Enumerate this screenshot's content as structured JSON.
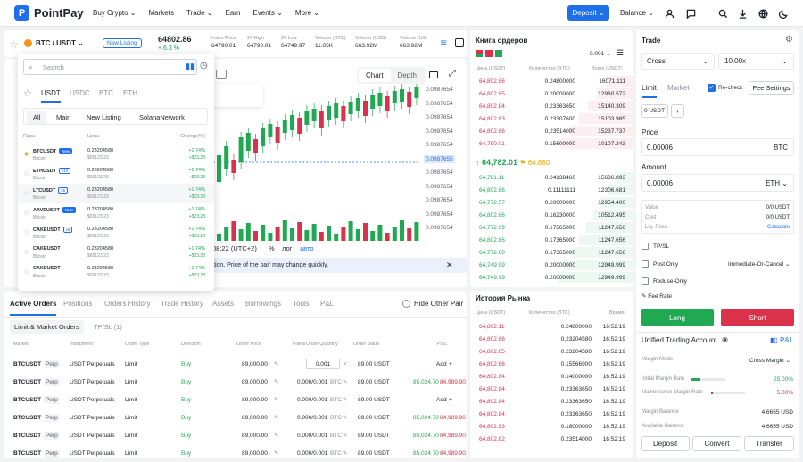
{
  "nav": {
    "brand": "PointPay",
    "items": [
      "Buy Crypto",
      "Markets",
      "Trade",
      "Earn",
      "Events",
      "More"
    ],
    "deposit": "Deposit",
    "balance": "Balance"
  },
  "ticker": {
    "pair": "BTC / USDT",
    "listing": "New Listing",
    "price": "64802.86",
    "change": "+ 6.3 %",
    "stats": [
      {
        "label": "Index Price",
        "value": "64790.01"
      },
      {
        "label": "24 High",
        "value": "64790.01"
      },
      {
        "label": "24 Low",
        "value": "64749.97"
      },
      {
        "label": "Volume (BTC)",
        "value": "11.05K"
      },
      {
        "label": "Volume (USD)",
        "value": "663.92M"
      },
      {
        "label": "Volume (USDT)",
        "value": "663.92M"
      }
    ]
  },
  "chart": {
    "tabs": [
      "Chart",
      "Depth"
    ],
    "y_labels": [
      "0.0987654",
      "0.0987654",
      "0.0987654",
      "0.0987654",
      "0.0987654",
      "0.0987655",
      "0.0987654",
      "0.0987654",
      "0.0987654",
      "0.0987654",
      "0.0987654"
    ],
    "highlight": "0.0987655",
    "time": "08:22 (UTC+2)",
    "pct": "%",
    "log": "лог",
    "auto": "авто",
    "notice": "tion. Price of the pair may change quickly."
  },
  "popup": {
    "search_placeholder": "Search",
    "quotes": [
      "USDT",
      "USDC",
      "BTC",
      "ETH"
    ],
    "cats": [
      "All",
      "Main",
      "New Listing",
      "SolanaNetwork"
    ],
    "col_pair": "Пара",
    "col_price": "Цена",
    "col_change": "Change(%)",
    "rows": [
      {
        "sym": "BTCUSDT",
        "badge": "New",
        "sub": "Bitcoin",
        "price": "0.23204580",
        "price2": "$65123.23",
        "ch": "+1.74%",
        "ch2": "+$23.23",
        "starred": true
      },
      {
        "sym": "ETHUSDT",
        "badge": "x10",
        "sub": "Bitcoin",
        "price": "0.23204580",
        "price2": "$65123.23",
        "ch": "+1.74%",
        "ch2": "+$23.23",
        "starred": false
      },
      {
        "sym": "LTCUSDT",
        "badge": "x5",
        "sub": "Bitcoin",
        "price": "0.23204580",
        "price2": "$65123.23",
        "ch": "+1.74%",
        "ch2": "+$23.23",
        "starred": false
      },
      {
        "sym": "AAVEUSDT",
        "badge": "New",
        "sub": "Bitcoin",
        "price": "0.23204580",
        "price2": "$65123.23",
        "ch": "+1.74%",
        "ch2": "+$23.23",
        "starred": false
      },
      {
        "sym": "CAKEUSDT",
        "badge": "x5",
        "sub": "Bitcoin",
        "price": "0.23204580",
        "price2": "$65123.23",
        "ch": "+1.74%",
        "ch2": "+$23.23",
        "starred": false
      },
      {
        "sym": "CAKEUSDT",
        "badge": "",
        "sub": "Bitcoin",
        "price": "0.23204580",
        "price2": "$65123.23",
        "ch": "+1.74%",
        "ch2": "+$23.23",
        "starred": false
      },
      {
        "sym": "CAKEUSDT",
        "badge": "",
        "sub": "Bitcoin",
        "price": "0.23204580",
        "price2": "$65123.23",
        "ch": "+1.74%",
        "ch2": "+$23.23",
        "starred": false
      }
    ]
  },
  "orders": {
    "tabs": [
      "Active Orders",
      "Positions",
      "Orders History",
      "Trade History",
      "Assets",
      "Borrowings",
      "Tools",
      "P&L"
    ],
    "hide_other": "Hide Other Pair",
    "subtabs": [
      "Limit & Market Orders",
      "TP/SL (1)"
    ],
    "cols": [
      "Market",
      "Instrument",
      "Order Type",
      "Direction",
      "Order Price",
      "Filled/Order Quantity",
      "Order Value",
      "TP/SL"
    ],
    "rows": [
      {
        "m": "BTCUSDT",
        "tag": "Perp",
        "inst": "USDT Perpetuals",
        "type": "Limit",
        "dir": "Buy",
        "price": "89,000.00",
        "qty": "0.001",
        "val": "89.00 USDT",
        "tp": "Add",
        "tp2": "",
        "edit": true
      },
      {
        "m": "BTCUSDT",
        "tag": "Perp",
        "inst": "USDT Perpetuals",
        "type": "Limit",
        "dir": "Buy",
        "price": "89,000.00",
        "qty": "0.000/0.001",
        "qtyu": "BTC",
        "val": "89.00 USDT",
        "tp": "85,024.70",
        "tp2": "84,989.90",
        "edit": false
      },
      {
        "m": "BTCUSDT",
        "tag": "Perp",
        "inst": "USDT Perpetuals",
        "type": "Limit",
        "dir": "Buy",
        "price": "89,000.00",
        "qty": "0.000/0.001",
        "qtyu": "BTC",
        "val": "89.00 USDT",
        "tp": "Add",
        "tp2": "",
        "edit": false
      },
      {
        "m": "BTCUSDT",
        "tag": "Perp",
        "inst": "USDT Perpetuals",
        "type": "Limit",
        "dir": "Buy",
        "price": "89,000.00",
        "qty": "0.000/0.001",
        "qtyu": "BTC",
        "val": "89.00 USDT",
        "tp": "85,024.70",
        "tp2": "84,989.90",
        "edit": false
      },
      {
        "m": "BTCUSDT",
        "tag": "Perp",
        "inst": "USDT Perpetuals",
        "type": "Limit",
        "dir": "Buy",
        "price": "89,000.00",
        "qty": "0.000/0.001",
        "qtyu": "BTC",
        "val": "89.00 USDT",
        "tp": "85,024.70",
        "tp2": "84,989.90",
        "edit": false
      },
      {
        "m": "BTCUSDT",
        "tag": "Perp",
        "inst": "USDT Perpetuals",
        "type": "Limit",
        "dir": "Buy",
        "price": "89,000.00",
        "qty": "0.000/0.001",
        "qtyu": "BTC",
        "val": "89.00 USDT",
        "tp": "85,024.70",
        "tp2": "84,989.90",
        "edit": false
      }
    ]
  },
  "book": {
    "title": "Книга ордеров",
    "step": "0.001",
    "cols": [
      "Цена (USDT)",
      "Количество (BTC)",
      "Всего (USDT)"
    ],
    "asks": [
      [
        "64,802.86",
        "0.24800000",
        "16071.111"
      ],
      [
        "64,802.85",
        "0.20000000",
        "12960.572"
      ],
      [
        "64,802.84",
        "0.23363650",
        "15140.309"
      ],
      [
        "64,802.83",
        "0.23307600",
        "15103.985"
      ],
      [
        "64,802.86",
        "0.23514000",
        "15237.737"
      ],
      [
        "64,790.01",
        "0.15600000",
        "10107.243"
      ]
    ],
    "mid": "64,782.01",
    "mid2": "64.860",
    "bids": [
      [
        "64,781.11",
        "0.24138460",
        "15636.893"
      ],
      [
        "64,802.86",
        "0.11111111",
        "12306.681"
      ],
      [
        "64,772.57",
        "0.20000000",
        "12954.400"
      ],
      [
        "64,802.86",
        "0.16230000",
        "10512.495"
      ],
      [
        "64,772.09",
        "0.17365000",
        "11247.656"
      ],
      [
        "64,802.86",
        "0.17365000",
        "11247.656"
      ],
      [
        "64,772.00",
        "0.17365000",
        "11247.656"
      ],
      [
        "64,749.99",
        "0.20000000",
        "12949.999"
      ],
      [
        "64,749.99",
        "0.20000000",
        "12949.999"
      ]
    ]
  },
  "hist": {
    "title": "История Рынка",
    "cols": [
      "Цена (USDT)",
      "Количество (BTC)",
      "Время"
    ],
    "rows": [
      [
        "64,802.11",
        "0.24800000",
        "16:52:19"
      ],
      [
        "64,802.86",
        "0.23204580",
        "16:52:19"
      ],
      [
        "64,802.85",
        "0.23204580",
        "16:52:19"
      ],
      [
        "64,802.86",
        "0.15566900",
        "16:52:19"
      ],
      [
        "64,802.84",
        "0.14000000",
        "16:52:19"
      ],
      [
        "64,802.84",
        "0.23363650",
        "16:52:19"
      ],
      [
        "64,802.84",
        "0.23363650",
        "16:52:19"
      ],
      [
        "64,802.84",
        "0.23363650",
        "16:52:19"
      ],
      [
        "64,802.83",
        "0.18000000",
        "16:52:19"
      ],
      [
        "64,802.82",
        "0.23514000",
        "16:52:19"
      ]
    ]
  },
  "trade": {
    "title": "Trade",
    "mode": "Cross",
    "lev": "10.00x",
    "tabs": [
      "Limit",
      "Market"
    ],
    "recheck": "Re-check",
    "fee_settings": "Fee Settings",
    "usdt": "0 USDT",
    "price_label": "Price",
    "price": "0.00006",
    "price_unit": "BTC",
    "amount_label": "Amount",
    "amount": "0.00006",
    "amount_unit": "ETH",
    "info": [
      {
        "k": "Value",
        "v": "0/0 USDT"
      },
      {
        "k": "Cost",
        "v": "0/0 USDT"
      },
      {
        "k": "Liq. Price",
        "v": "Calculate"
      }
    ],
    "tpsl": "TP/SL",
    "post_only": "Post Only",
    "ioc": "Immediate-Or-Cancel",
    "reduce": "Reduse-Only",
    "fee_rate": "Fee Rate",
    "long": "Long",
    "short": "Short",
    "uta": "Unified Trading Account",
    "pl": "P&L",
    "margin": [
      {
        "k": "Margin Mode",
        "v": "Cross Margin"
      },
      {
        "k": "Initial Margin Rate",
        "v": "25.00%"
      },
      {
        "k": "Maintenance Margin Rate",
        "v": "5.00%"
      }
    ],
    "bal": [
      {
        "k": "Margin Balance",
        "v": "4.6655 USD"
      },
      {
        "k": "Available Balance",
        "v": "4.6655 USD"
      }
    ],
    "actions": [
      "Deposit",
      "Convert",
      "Transfer"
    ]
  },
  "colors": {
    "accent": "#1f6feb",
    "up": "#20a853",
    "down": "#d9324a"
  }
}
